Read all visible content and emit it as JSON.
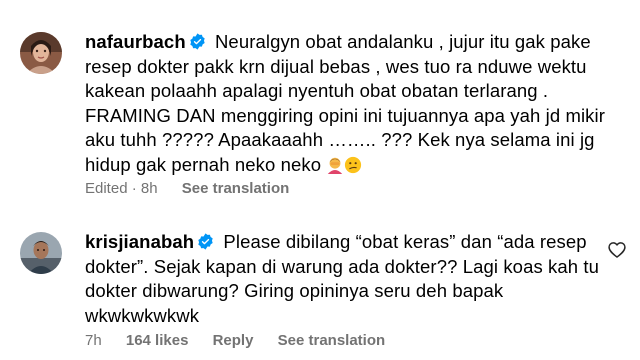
{
  "comments": [
    {
      "username": "nafaurbach",
      "text": "Neuralgyn obat andalanku , jujur itu gak pake resep dokter pakk krn dijual bebas , wes tuo ra nduwe wektu kakean polaahh apalagi nyentuh obat obatan terlarang . FRAMING DAN menggiring opini ini tujuannya apa yah jd mikir aku tuhh ????? Apaakaaahh …….. ??? Kek nya selama ini jg hidup gak pernah neko neko",
      "meta": {
        "edited": "Edited",
        "dot": "·",
        "time": "8h",
        "translation": "See translation"
      }
    },
    {
      "username": "krisjianabah",
      "text": "Please dibilang “obat keras” dan “ada resep dokter”. Sejak kapan di warung ada dokter?? Lagi koas kah tu dokter dibwarung? Giring opininya seru deh bapak wkwkwkwkwk",
      "meta": {
        "time": "7h",
        "likes": "164 likes",
        "reply": "Reply",
        "translation": "See translation"
      }
    }
  ],
  "icons": {
    "verified": "verified-badge-icon",
    "like": "heart-outline-icon",
    "emoji_1": "person-facepalming-emoji",
    "emoji_2": "confused-face-emoji"
  },
  "colors": {
    "verified": "#0095f6",
    "meta_text": "#737373",
    "text": "#000000"
  }
}
